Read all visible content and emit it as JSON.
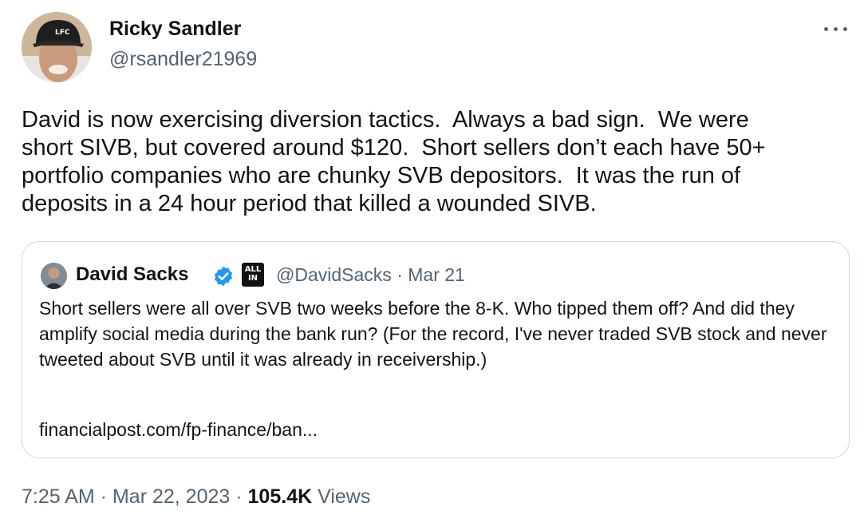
{
  "tweet": {
    "author": {
      "name": "Ricky Sandler",
      "handle": "@rsandler21969",
      "hat_text": "LFC"
    },
    "more_icon": "ellipsis-icon",
    "text": "David is now exercising diversion tactics.  Always a bad sign.  We were\nshort SIVB, but covered around $120.  Short sellers don’t each have 50+\nportfolio companies who are chunky SVB depositors.  It was the run of\ndeposits in a 24 hour period that killed a wounded SIVB.",
    "quote": {
      "author_name": "David Sacks",
      "verified_icon": "verified-badge-icon",
      "affiliation_badge": "ALL IN",
      "handle": "@DavidSacks",
      "separator": "·",
      "date": "Mar 21",
      "text": "Short sellers were all over SVB two weeks before the 8-K. Who tipped them off? And did they amplify social media during the bank run? (For the record, I've never traded SVB stock and never tweeted about SVB until it was already in receivership.)",
      "link": "financialpost.com/fp-finance/ban..."
    },
    "footer": {
      "time": "7:25 AM",
      "separator": "·",
      "date": "Mar 22, 2023",
      "views_count": "105.4K",
      "views_label": "Views"
    },
    "colors": {
      "text_primary": "#0f1419",
      "text_secondary": "#536471",
      "border": "#cfd9de",
      "verified": "#1d9bf0"
    }
  }
}
